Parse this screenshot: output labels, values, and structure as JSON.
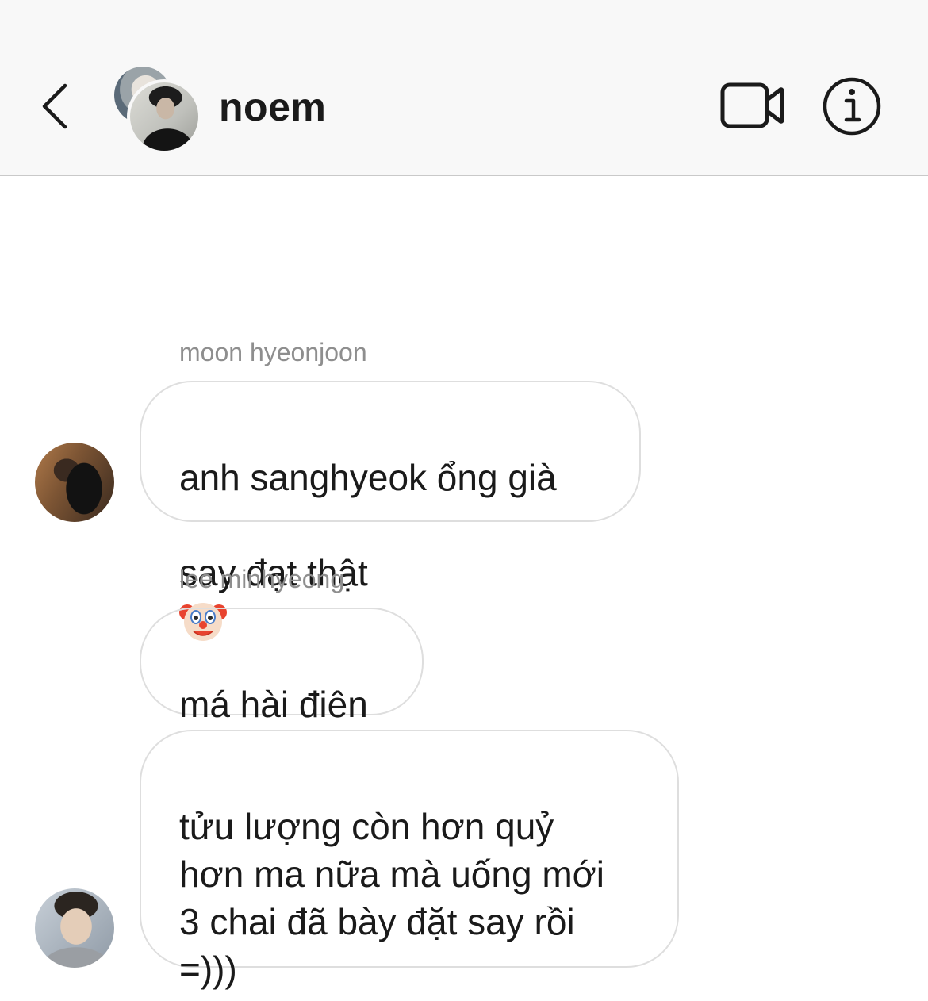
{
  "header": {
    "chat_name": "noem"
  },
  "icons": {
    "back": "chevron-left-icon",
    "video": "video-camera-icon",
    "info": "info-icon"
  },
  "messages": [
    {
      "sender": "moon hyeonjoon",
      "text_1": "anh sanghyeok ổng già",
      "text_2": "say đạt thật",
      "emoji": "clown-face-emoji"
    },
    {
      "sender": "lee minhyeong",
      "text": "má hài điên"
    },
    {
      "text": "tửu lượng còn hơn quỷ\nhơn ma nữa mà uống mới\n3 chai đã bày đặt say rồi\n=)))"
    }
  ],
  "colors": {
    "header_bg": "#f8f8f8",
    "bubble_border": "#dedede",
    "sender_label": "#8e8e8e"
  }
}
